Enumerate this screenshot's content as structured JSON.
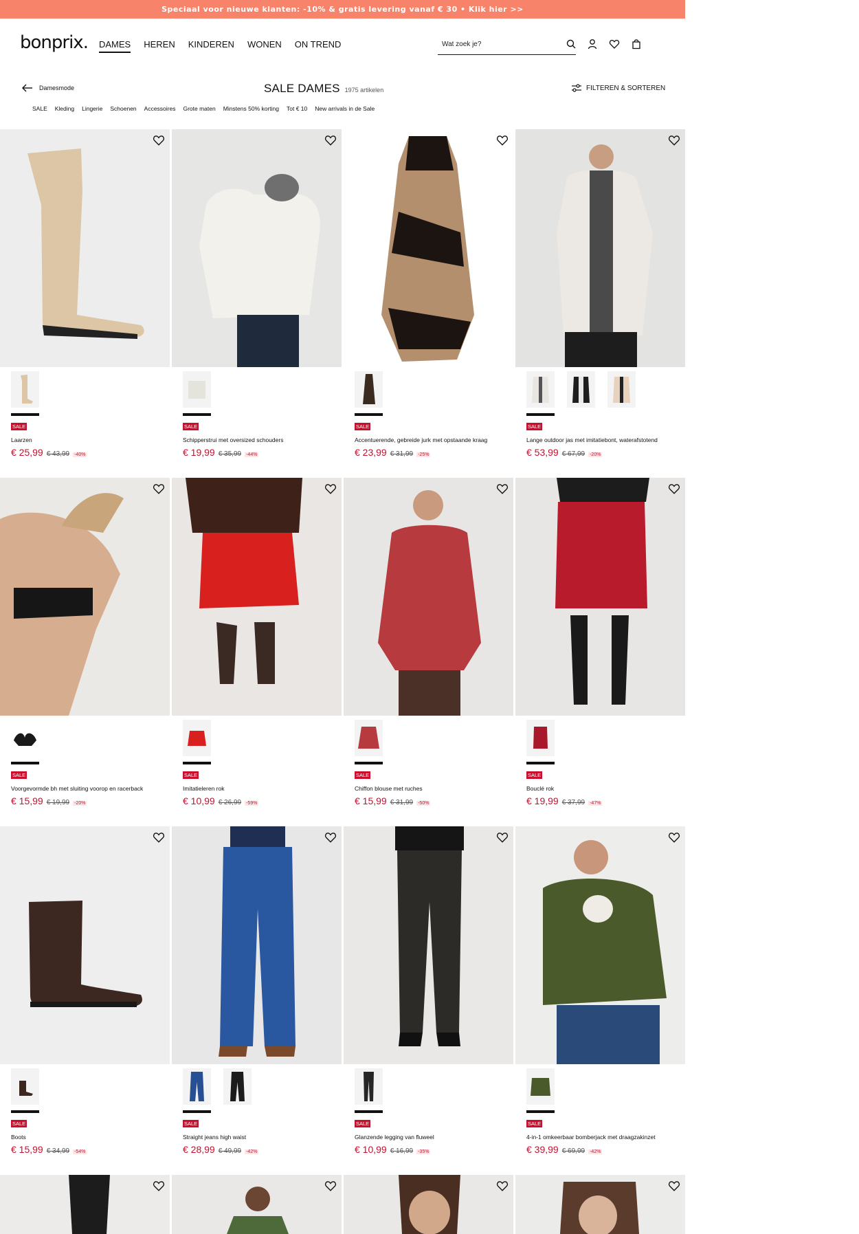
{
  "promo": {
    "text": "Speciaal voor nieuwe klanten: -10% & gratis levering vanaf € 30 • Klik hier >>"
  },
  "header": {
    "logo": "bonprix.",
    "nav": [
      "DAMES",
      "HEREN",
      "KINDEREN",
      "WONEN",
      "ON TREND"
    ],
    "search_placeholder": "Wat zoek je?"
  },
  "subbar": {
    "back_label": "Damesmode",
    "title": "SALE DAMES",
    "count": "1975 artikelen",
    "filter_label": "FILTEREN & SORTEREN",
    "categories": [
      "SALE",
      "Kleding",
      "Lingerie",
      "Schoenen",
      "Accessoires",
      "Grote maten",
      "Minstens 50% korting",
      "Tot € 10",
      "New arrivals in de Sale"
    ]
  },
  "colors": {
    "promo": "#f8836b",
    "sale_red": "#c8102e"
  },
  "products": [
    {
      "name": "Laarzen",
      "price": "€ 25,99",
      "old": "€ 43,99",
      "disc": "-40%",
      "badge": "SALE",
      "variants": [
        "beige"
      ]
    },
    {
      "name": "Schipperstrui met oversized schouders",
      "price": "€ 19,99",
      "old": "€ 35,99",
      "disc": "-44%",
      "badge": "SALE",
      "variants": [
        "offwhite"
      ]
    },
    {
      "name": "Accentuerende, gebreide jurk met opstaande kraag",
      "price": "€ 23,99",
      "old": "€ 31,99",
      "disc": "-25%",
      "badge": "SALE",
      "variants": [
        "pattern"
      ]
    },
    {
      "name": "Lange outdoor jas met imitatiebont, waterafstotend",
      "price": "€ 53,99",
      "old": "€ 67,99",
      "disc": "-20%",
      "badge": "SALE",
      "variants": [
        "lightgrey",
        "black",
        "cream"
      ]
    },
    {
      "name": "Voorgevormde bh met sluiting voorop en racerback",
      "price": "€ 15,99",
      "old": "€ 19,99",
      "disc": "-20%",
      "badge": "SALE",
      "variants": [
        "black"
      ]
    },
    {
      "name": "Imitatieleren rok",
      "price": "€ 10,99",
      "old": "€ 26,99",
      "disc": "-59%",
      "badge": "SALE",
      "variants": [
        "red"
      ]
    },
    {
      "name": "Chiffon blouse met ruches",
      "price": "€ 15,99",
      "old": "€ 31,99",
      "disc": "-50%",
      "badge": "SALE",
      "variants": [
        "redprint"
      ]
    },
    {
      "name": "Bouclé rok",
      "price": "€ 19,99",
      "old": "€ 37,99",
      "disc": "-47%",
      "badge": "SALE",
      "variants": [
        "redcheck"
      ]
    },
    {
      "name": "Boots",
      "price": "€ 15,99",
      "old": "€ 34,99",
      "disc": "-54%",
      "badge": "SALE",
      "variants": [
        "brown"
      ]
    },
    {
      "name": "Straight jeans high waist",
      "price": "€ 28,99",
      "old": "€ 49,99",
      "disc": "-42%",
      "badge": "SALE",
      "variants": [
        "denim",
        "black"
      ]
    },
    {
      "name": "Glanzende legging van fluweel",
      "price": "€ 10,99",
      "old": "€ 16,99",
      "disc": "-35%",
      "badge": "SALE",
      "variants": [
        "black"
      ]
    },
    {
      "name": "4-in-1 omkeerbaar bomberjack met draagzakinzet",
      "price": "€ 39,99",
      "old": "€ 69,99",
      "disc": "-42%",
      "badge": "SALE",
      "variants": [
        "olive"
      ]
    },
    {
      "name": "",
      "price": "",
      "old": "",
      "disc": "",
      "badge": "",
      "variants": []
    },
    {
      "name": "",
      "price": "",
      "old": "",
      "disc": "",
      "badge": "",
      "variants": []
    },
    {
      "name": "",
      "price": "",
      "old": "",
      "disc": "",
      "badge": "",
      "variants": []
    },
    {
      "name": "",
      "price": "",
      "old": "",
      "disc": "",
      "badge": "",
      "variants": []
    }
  ]
}
